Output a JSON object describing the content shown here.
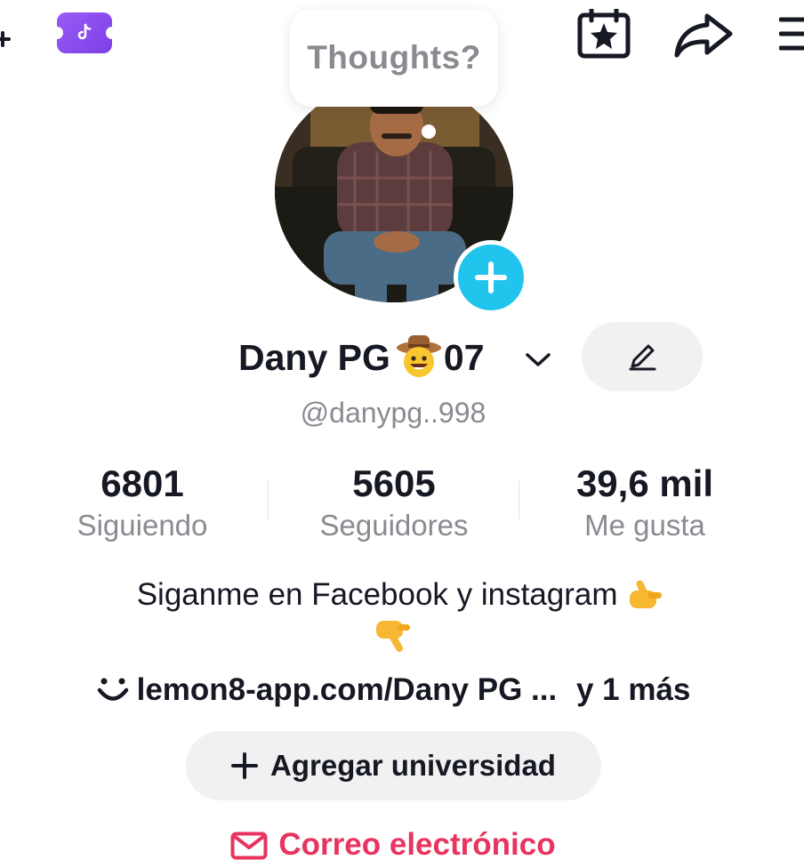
{
  "header": {
    "add_icon": "plus-icon",
    "ticket_icon": "tiktok-ticket-icon",
    "calendar_icon": "calendar-star-icon",
    "share_icon": "share-arrow-icon",
    "menu_icon": "hamburger-menu-icon"
  },
  "thoughts_bubble": {
    "text": "Thoughts?"
  },
  "profile": {
    "display_name": "Dany PG",
    "name_emoji": "cowboy-face-emoji",
    "name_suffix": "07",
    "username": "@danypg..998"
  },
  "stats": [
    {
      "value": "6801",
      "label": "Siguiendo"
    },
    {
      "value": "5605",
      "label": "Seguidores"
    },
    {
      "value": "39,6 mil",
      "label": "Me gusta"
    }
  ],
  "bio": {
    "text": "Siganme en Facebook y  instagram",
    "emoji_1": "pointing-right-emoji",
    "emoji_2": "pointing-down-emoji"
  },
  "link": {
    "text": "lemon8-app.com/Dany PG ...",
    "more": "y 1 más"
  },
  "add_university": {
    "label": "Agregar universidad"
  },
  "email": {
    "label": "Correo electrónico"
  },
  "colors": {
    "accent_cyan": "#20C4EC",
    "ticket_purple": "#8B4DF0",
    "email_red": "#E8345F",
    "muted_gray": "#8A8B91"
  }
}
